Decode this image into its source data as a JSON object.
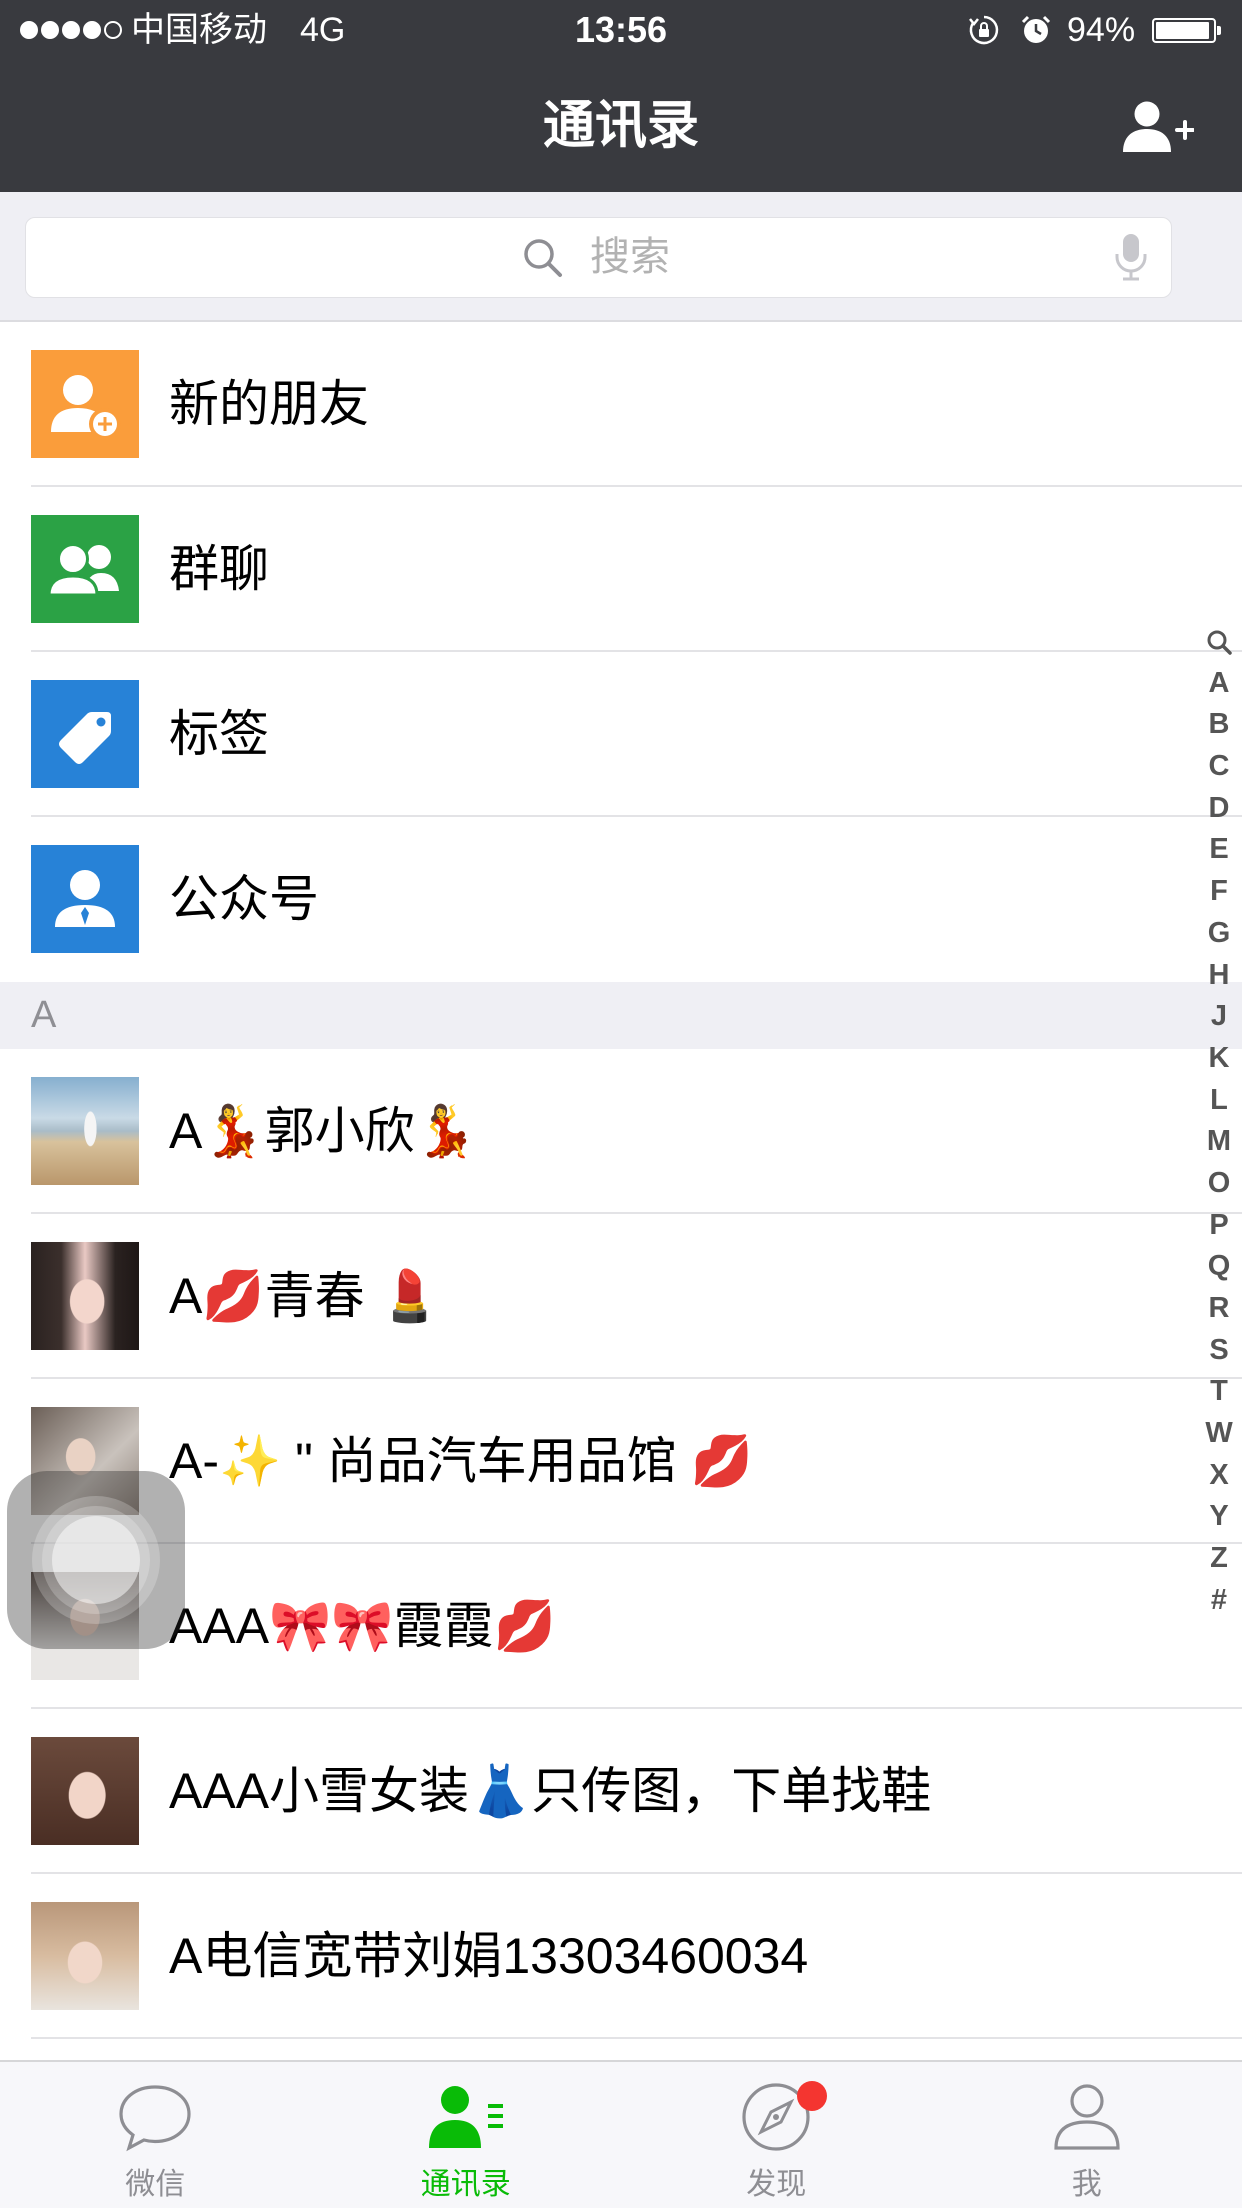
{
  "theme": {
    "nav_bg": "#393A3F",
    "accent": "#09BB07",
    "tab_inactive": "#8E8E93",
    "new_friends_icon": "#FA9D3B",
    "group_chat_icon": "#2BA245",
    "tags_icon": "#2782D7",
    "official_accounts_icon": "#2782D7",
    "badge": "#F43530"
  },
  "status_bar": {
    "signal_strength": 4,
    "signal_max": 5,
    "carrier": "中国移动",
    "network": "4G",
    "time": "13:56",
    "icons": [
      "rotation-lock-icon",
      "alarm-icon",
      "battery-icon"
    ],
    "battery_percent": "94%",
    "battery_level": 0.94
  },
  "nav": {
    "title": "通讯录",
    "action_icon": "add-contact-icon"
  },
  "search": {
    "placeholder": "搜索",
    "icon": "search-icon",
    "voice_icon": "microphone-icon"
  },
  "fixed_entries": [
    {
      "label": "新的朋友",
      "icon": "new-friend-icon"
    },
    {
      "label": "群聊",
      "icon": "group-chat-icon"
    },
    {
      "label": "标签",
      "icon": "tag-icon"
    },
    {
      "label": "公众号",
      "icon": "official-account-icon"
    }
  ],
  "sections": [
    {
      "letter": "A",
      "contacts": [
        {
          "name": "A💃郭小欣💃"
        },
        {
          "name": "A💋青春 💄"
        },
        {
          "name": "A-✨ \" 尚品汽车用品馆 💋"
        },
        {
          "name": "AAA🎀🎀霞霞💋"
        },
        {
          "name": "AAA小雪女装👗只传图，下单找鞋"
        },
        {
          "name": "A电信宽带刘娟13303460034"
        }
      ]
    }
  ],
  "index_bar": {
    "search_icon": "search-icon",
    "letters": [
      "A",
      "B",
      "C",
      "D",
      "E",
      "F",
      "G",
      "H",
      "J",
      "K",
      "L",
      "M",
      "O",
      "P",
      "Q",
      "R",
      "S",
      "T",
      "W",
      "X",
      "Y",
      "Z",
      "#"
    ]
  },
  "tab_bar": {
    "tabs": [
      {
        "label": "微信",
        "icon": "chat-bubble-icon",
        "active": false,
        "badge_dot": false
      },
      {
        "label": "通讯录",
        "icon": "contacts-icon",
        "active": true,
        "badge_dot": false
      },
      {
        "label": "发现",
        "icon": "compass-icon",
        "active": false,
        "badge_dot": true
      },
      {
        "label": "我",
        "icon": "me-icon",
        "active": false,
        "badge_dot": false
      }
    ]
  },
  "assistive_touch": {
    "icon": "assistive-touch-icon"
  }
}
